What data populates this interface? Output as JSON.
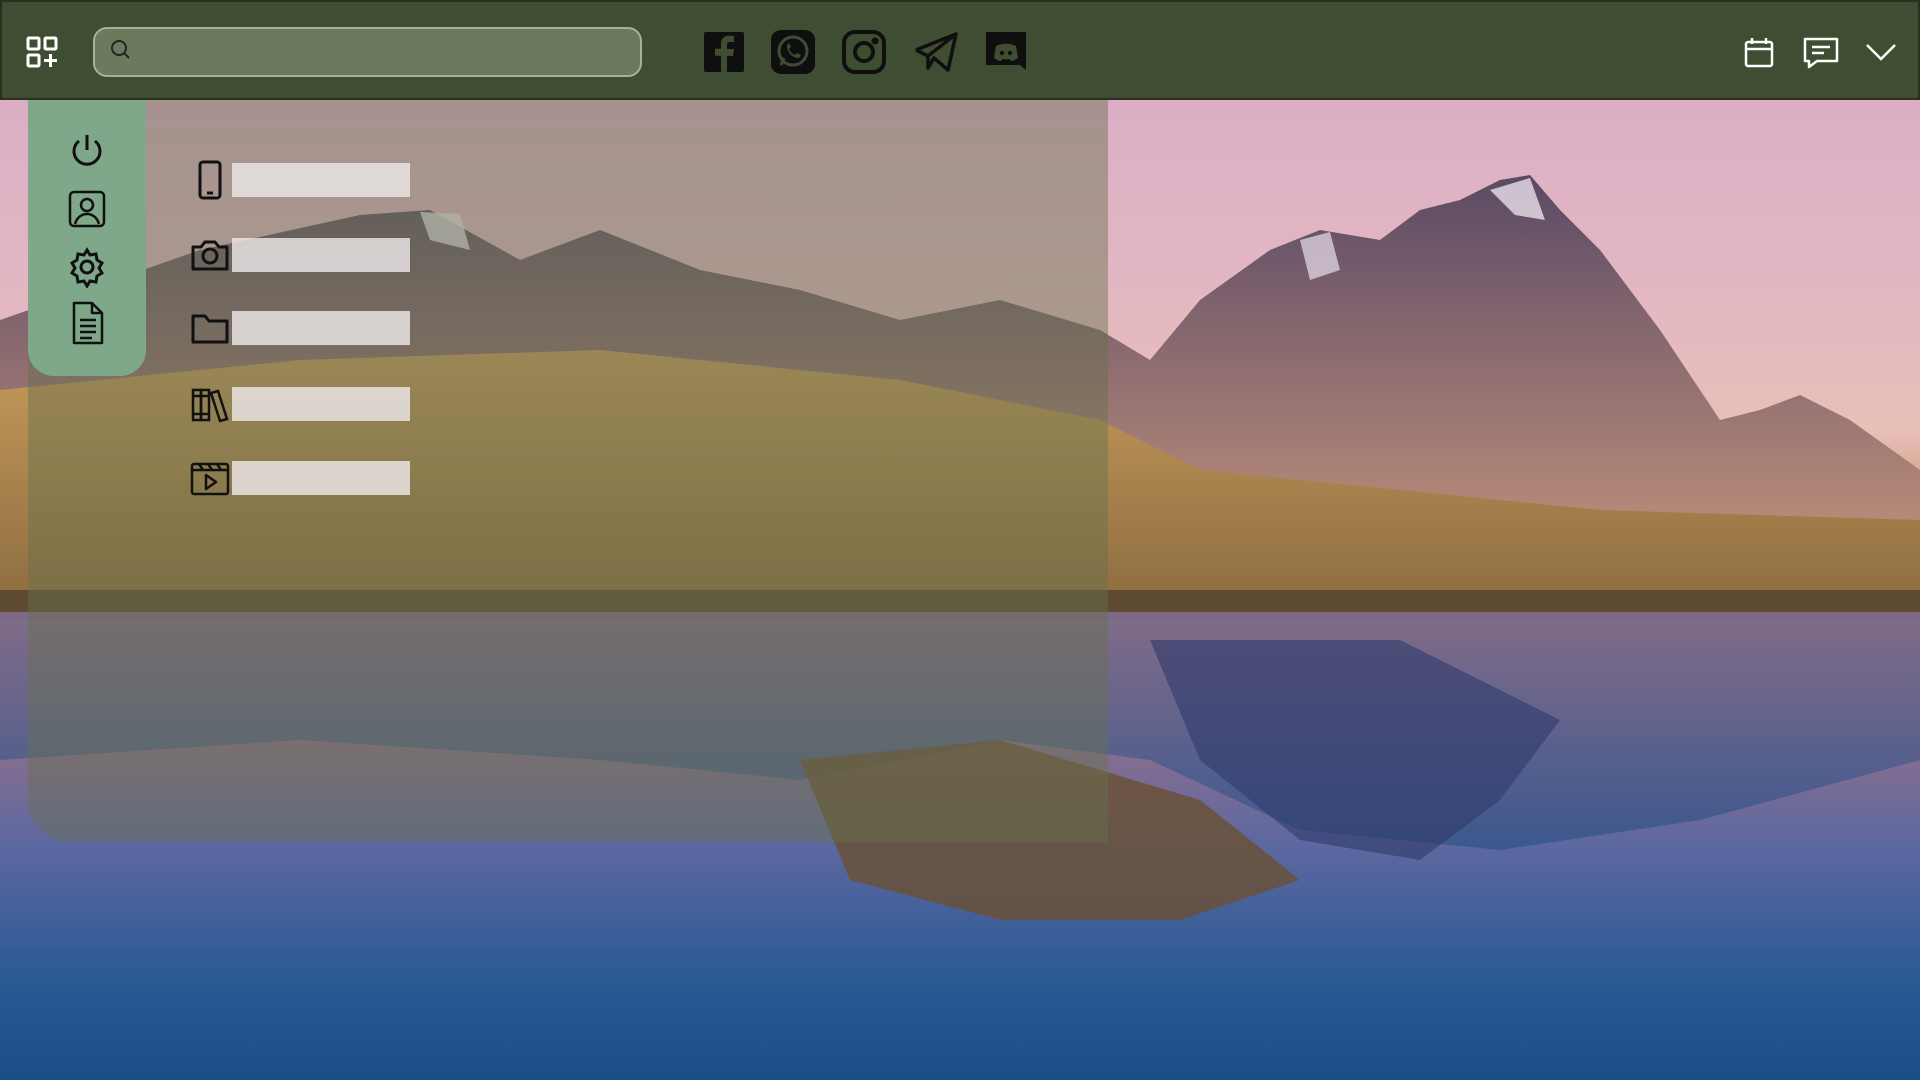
{
  "wallpaper": {
    "description_colors": {
      "sky": "#d8a9c7",
      "water": "#1a4d88",
      "grass": "#b08a4e"
    }
  },
  "topbar": {
    "background": "#3f4d33",
    "apps_icon": "apps-add-icon",
    "search": {
      "placeholder": "",
      "value": ""
    },
    "social": [
      {
        "name": "facebook",
        "icon": "facebook-icon"
      },
      {
        "name": "whatsapp",
        "icon": "whatsapp-icon"
      },
      {
        "name": "instagram",
        "icon": "instagram-icon"
      },
      {
        "name": "telegram",
        "icon": "telegram-icon"
      },
      {
        "name": "discord",
        "icon": "discord-icon"
      }
    ],
    "right_icons": [
      "calendar-icon",
      "message-icon",
      "chevron-down-icon"
    ]
  },
  "rail": {
    "background": "#7ea889",
    "items": [
      "power-icon",
      "user-icon",
      "settings-icon",
      "document-icon"
    ]
  },
  "apps": [
    {
      "icon": "phone-icon",
      "label": ""
    },
    {
      "icon": "camera-icon",
      "label": ""
    },
    {
      "icon": "folder-icon",
      "label": ""
    },
    {
      "icon": "library-icon",
      "label": ""
    },
    {
      "icon": "video-icon",
      "label": ""
    }
  ]
}
